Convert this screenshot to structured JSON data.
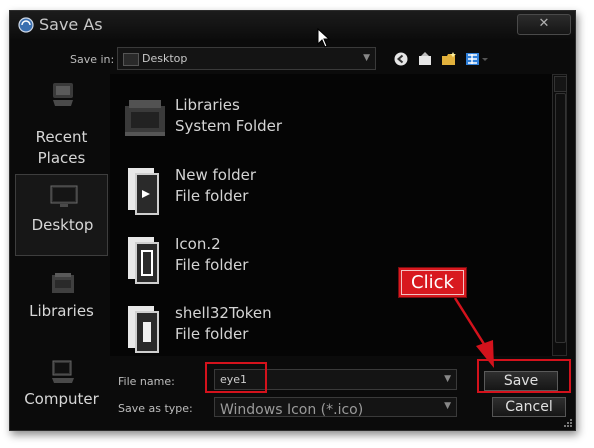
{
  "window": {
    "title": "Save As",
    "close_label": "✕"
  },
  "save_in": {
    "label": "Save in:",
    "value": "Desktop"
  },
  "places": [
    {
      "label_line1": "Recent",
      "label_line2": "Places",
      "icon": "recent-places-icon"
    },
    {
      "label_line1": "Desktop",
      "label_line2": "",
      "icon": "desktop-icon"
    },
    {
      "label_line1": "Libraries",
      "label_line2": "",
      "icon": "libraries-icon"
    },
    {
      "label_line1": "Computer",
      "label_line2": "",
      "icon": "computer-icon"
    }
  ],
  "places_selected": "Desktop",
  "files": [
    {
      "name": "Libraries",
      "type": "System Folder",
      "icon": "libraries-folder-icon"
    },
    {
      "name": "New folder",
      "type": "File folder",
      "icon": "folder-icon"
    },
    {
      "name": "Icon.2",
      "type": "File folder",
      "icon": "folder-icon"
    },
    {
      "name": "shell32Token",
      "type": "File folder",
      "icon": "folder-icon"
    }
  ],
  "file_name": {
    "label": "File name:",
    "value": "eye1"
  },
  "save_as_type": {
    "label": "Save as type:",
    "value": "Windows Icon (*.ico)"
  },
  "buttons": {
    "save": "Save",
    "cancel": "Cancel"
  },
  "annotation": {
    "text": "Click",
    "color": "#d4121c"
  }
}
